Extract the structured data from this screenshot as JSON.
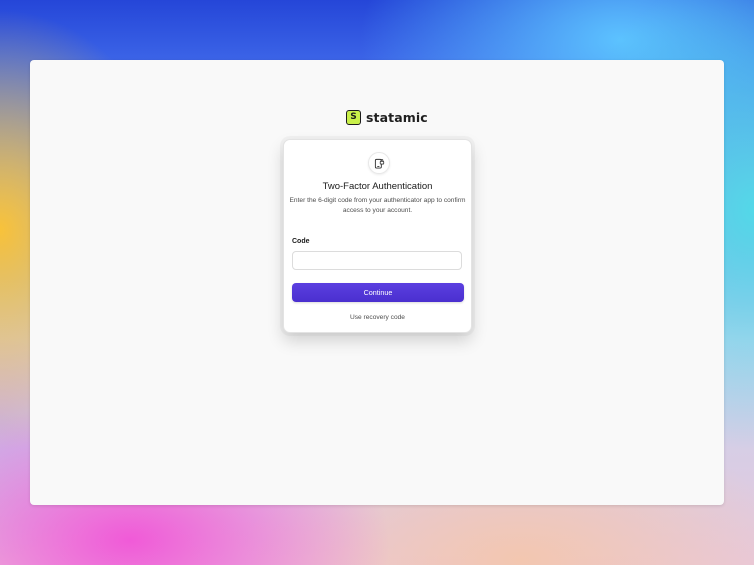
{
  "brand": {
    "logo_letter": "S",
    "name": "statamic",
    "accent_color": "#c9f04a"
  },
  "auth": {
    "icon": "phone-lock-icon",
    "title": "Two-Factor Authentication",
    "description": "Enter the 6-digit code from your authenticator app to confirm access to your account.",
    "code_label": "Code",
    "code_value": "",
    "continue_label": "Continue",
    "recovery_label": "Use recovery code",
    "button_color": "#4f35d6"
  }
}
